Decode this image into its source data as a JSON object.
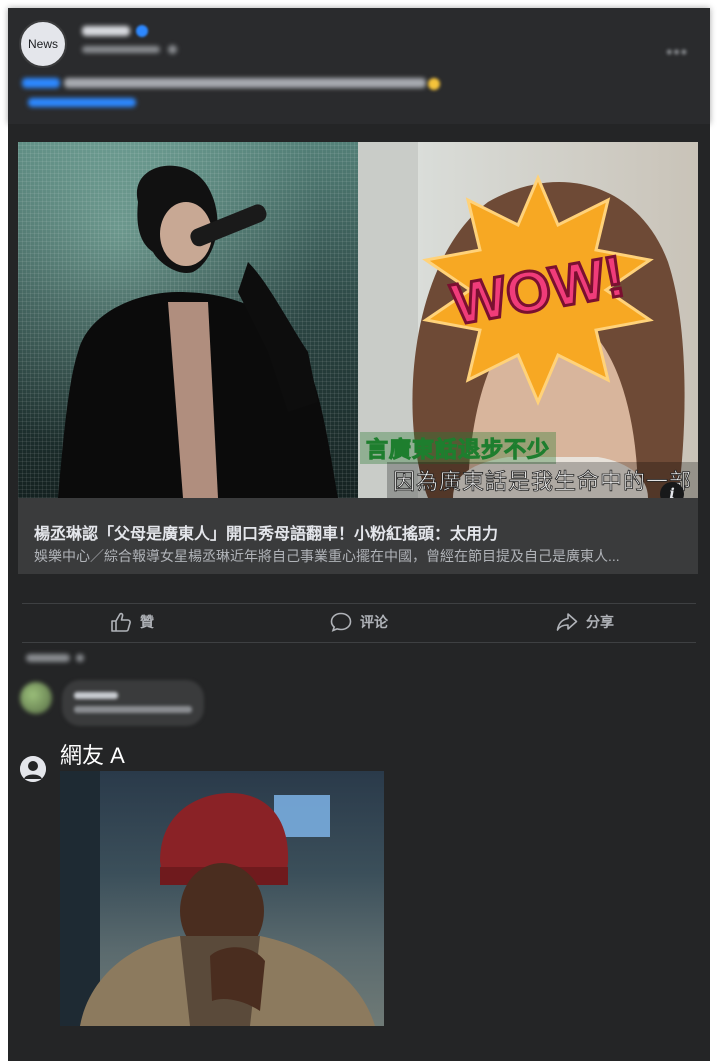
{
  "post": {
    "page_avatar_text": "News"
  },
  "link_preview": {
    "title": "楊丞琳認「父母是廣東人」開口秀母語翻車！小粉紅搖頭：太用力",
    "description": "娛樂中心／綜合報導女星楊丞琳近年將自己事業重心擺在中國，曾經在節目提及自己是廣東人..."
  },
  "image": {
    "subtitle_line1": "言廣東話退步不少",
    "subtitle_line2": "因為廣東話是我生命中的一部",
    "sticker_text": "WOW!",
    "info_glyph": "i"
  },
  "actions": {
    "like_label": "贊",
    "comment_label": "评论",
    "share_label": "分享"
  },
  "comment": {
    "user_name": "網友 A"
  },
  "colors": {
    "background": "#242526",
    "preview_background": "#3a3b3c",
    "text_primary": "#e4e6eb",
    "text_secondary": "#b0b3b8",
    "verified_blue": "#2d88ff",
    "sticker_orange": "#f7a823",
    "sticker_pink": "#f03c7a"
  },
  "icons": {
    "like": "thumbs-up-icon",
    "comment": "speech-bubble-icon",
    "share": "share-arrow-icon",
    "more": "more-dots-icon",
    "info": "info-icon",
    "user": "user-silhouette-icon"
  }
}
